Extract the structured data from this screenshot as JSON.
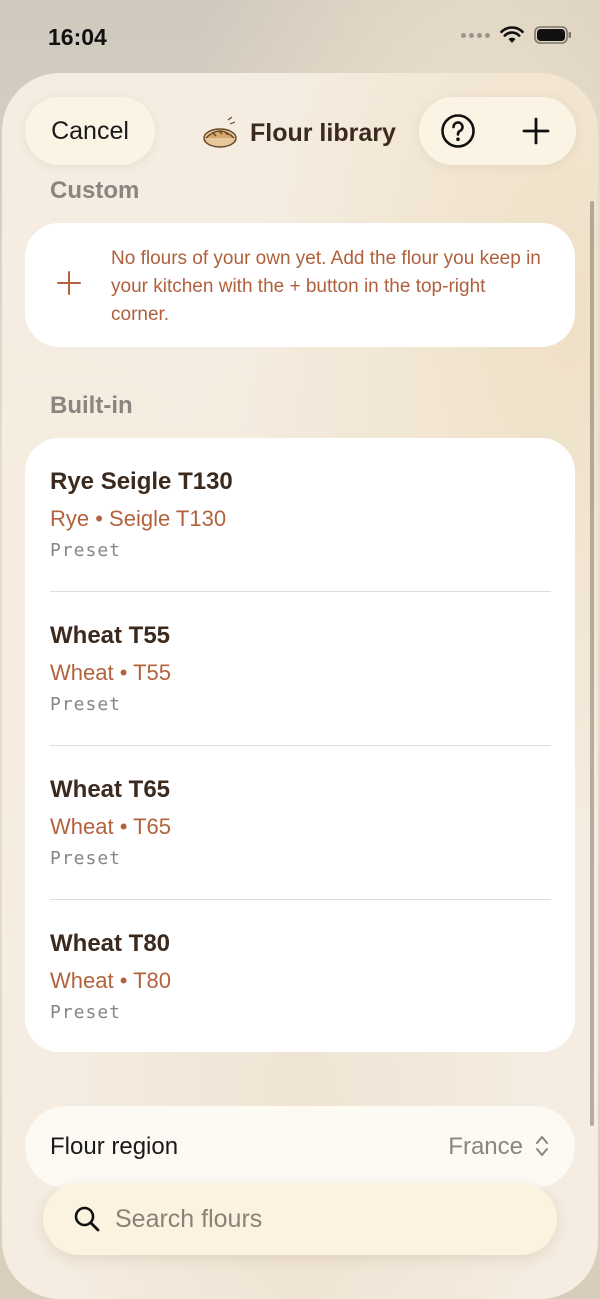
{
  "status": {
    "time": "16:04"
  },
  "nav": {
    "cancel_label": "Cancel",
    "title": "Flour library"
  },
  "sections": {
    "custom_header": "Custom",
    "custom_empty_text": "No flours of your own yet. Add the flour you keep in your kitchen with the + button in the top-right corner.",
    "builtin_header": "Built-in"
  },
  "flours": [
    {
      "name": "Rye Seigle T130",
      "subtitle": "Rye • Seigle T130",
      "tag": "Preset"
    },
    {
      "name": "Wheat T55",
      "subtitle": "Wheat • T55",
      "tag": "Preset"
    },
    {
      "name": "Wheat T65",
      "subtitle": "Wheat • T65",
      "tag": "Preset"
    },
    {
      "name": "Wheat T80",
      "subtitle": "Wheat • T80",
      "tag": "Preset"
    }
  ],
  "region": {
    "label": "Flour region",
    "value": "France"
  },
  "search": {
    "placeholder": "Search flours"
  },
  "icons": {
    "title_icon": "bread-icon",
    "help": "question-circle-icon",
    "add": "plus-icon",
    "region": "chevron-up-down-icon",
    "search": "magnifying-glass-icon"
  },
  "colors": {
    "accent": "#b2623d",
    "title_text": "#3b2a1d",
    "secondary_text": "#8a8580"
  }
}
